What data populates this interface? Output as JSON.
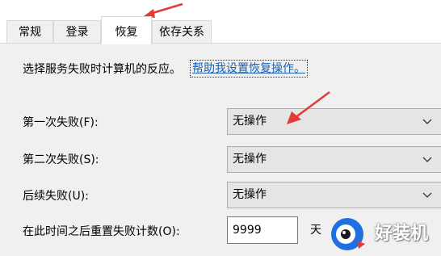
{
  "tabs": [
    {
      "label": "常规"
    },
    {
      "label": "登录"
    },
    {
      "label": "恢复"
    },
    {
      "label": "依存关系"
    }
  ],
  "recovery": {
    "intro_label": "选择服务失败时计算机的反应。",
    "help_link": "帮助我设置恢复操作。",
    "rows": [
      {
        "label": "第一次失败(F):",
        "value": "无操作"
      },
      {
        "label": "第二次失败(S):",
        "value": "无操作"
      },
      {
        "label": "后续失败(U):",
        "value": "无操作"
      }
    ],
    "reset_label": "在此时间之后重置失败计数(O):",
    "reset_value": "9999",
    "reset_unit": "天"
  },
  "watermark": {
    "text": "好装机"
  },
  "colors": {
    "annotation_arrow": "#e53935",
    "link": "#1a5fb4",
    "panel": "#f0f0f0"
  }
}
